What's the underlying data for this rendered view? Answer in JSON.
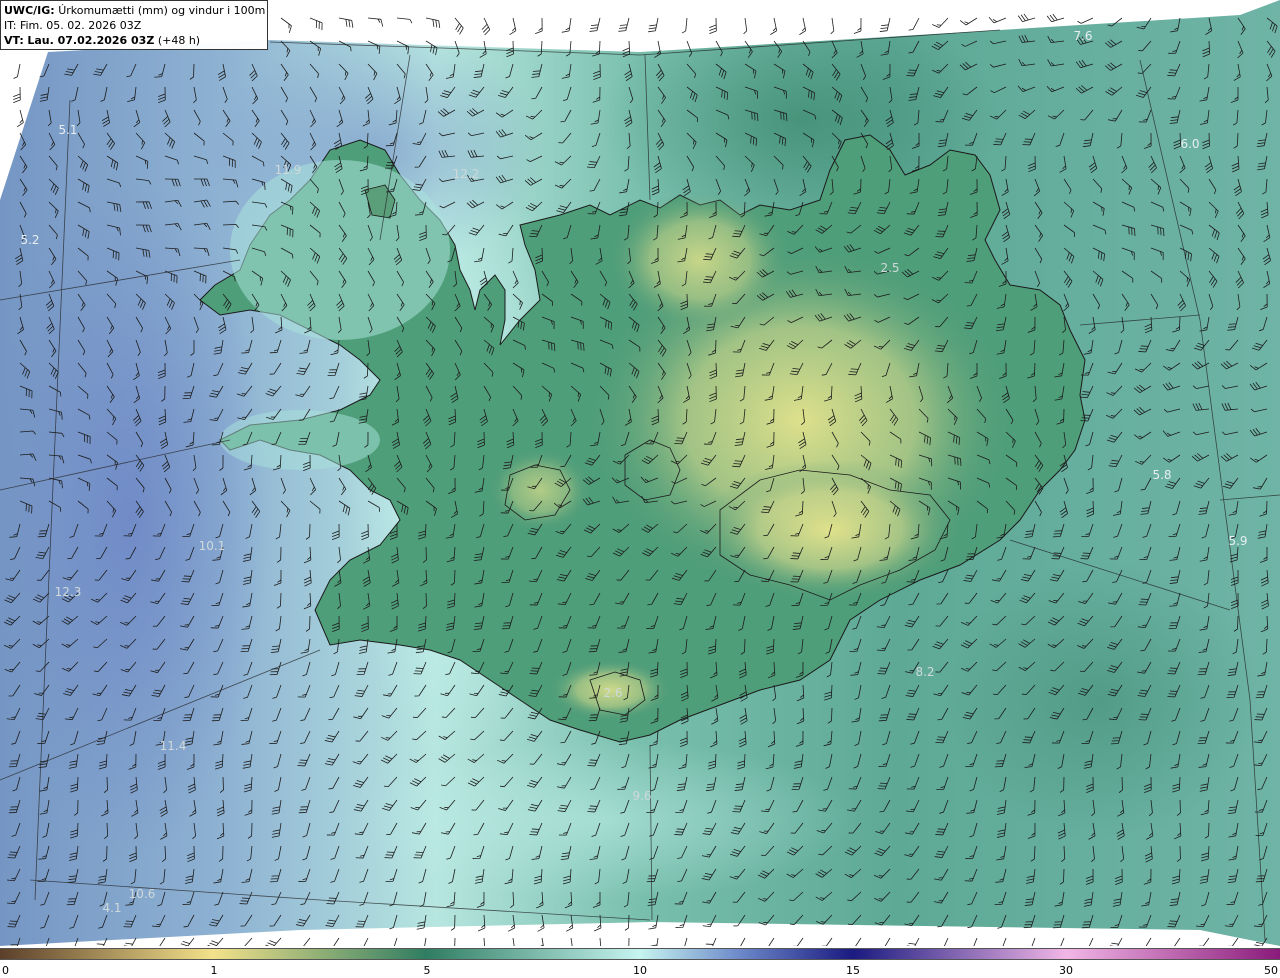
{
  "header": {
    "model": "UWC/IG:",
    "title": "Úrkomumætti (mm) og vindur i 100m hæð",
    "initial_time": "IT: Fim. 05. 02. 2026 03Z",
    "valid_label": "VT:",
    "valid_time": "Lau. 07.02.2026 03Z",
    "lead": "(+48 h)"
  },
  "point_labels": [
    "7.6",
    "5.1",
    "11.9",
    "12.2",
    "6.0",
    "5.2",
    "2.5",
    "5.8",
    "5.9",
    "10.1",
    "12.3",
    "8.2",
    "2.6",
    "11.4",
    "9.6",
    "10.6",
    "4.1"
  ],
  "colorbar": {
    "ticks": [
      "0",
      "1",
      "5",
      "10",
      "15",
      "30",
      "50"
    ],
    "colors": {
      "stop_0": "#5b3f2a",
      "stop_1": "#f3e28a",
      "stop_5": "#2f7d62",
      "stop_10": "#c6f4f0",
      "stop_12": "#6a86c8",
      "stop_15": "#1a1a80",
      "stop_30": "#f1b6e6",
      "stop_50": "#8a1a7a"
    }
  },
  "map_colors": {
    "sea_teal": "#6fb5a6",
    "land_green": "#3f8f6e",
    "land_yellow": "#d9df8c",
    "west_blue": "#7fa0c9",
    "light_cyan": "#b5e8e2"
  },
  "icons": [
    "wind-barb-icon"
  ]
}
